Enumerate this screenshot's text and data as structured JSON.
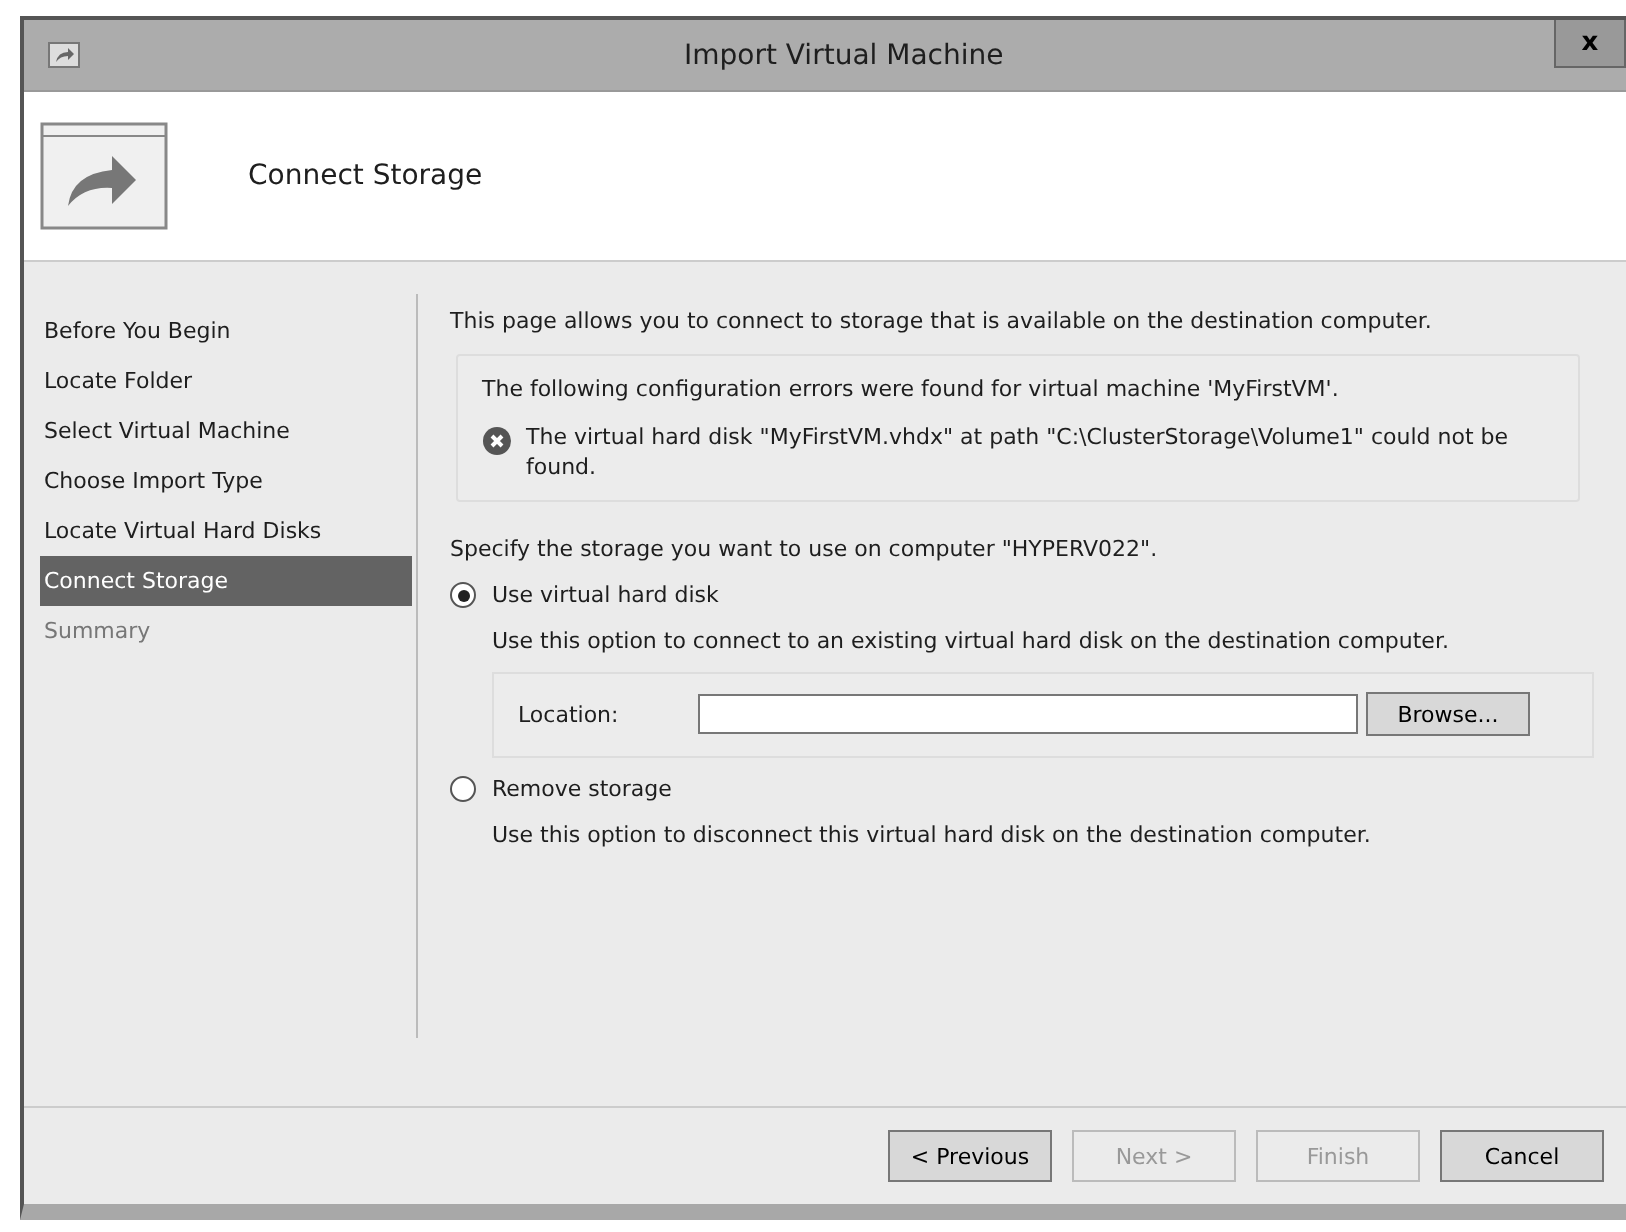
{
  "window": {
    "title": "Import Virtual Machine",
    "close": "x"
  },
  "header": {
    "title": "Connect Storage"
  },
  "steps": [
    {
      "label": "Before You Begin",
      "selected": false,
      "disabled": false
    },
    {
      "label": "Locate Folder",
      "selected": false,
      "disabled": false
    },
    {
      "label": "Select Virtual Machine",
      "selected": false,
      "disabled": false
    },
    {
      "label": "Choose Import Type",
      "selected": false,
      "disabled": false
    },
    {
      "label": "Locate Virtual Hard Disks",
      "selected": false,
      "disabled": false
    },
    {
      "label": "Connect Storage",
      "selected": true,
      "disabled": false
    },
    {
      "label": "Summary",
      "selected": false,
      "disabled": true
    }
  ],
  "intro": "This page allows you to connect to storage that is available on the destination computer.",
  "errors": {
    "heading": "The following configuration errors were found for virtual machine 'MyFirstVM'.",
    "items": [
      "The virtual hard disk \"MyFirstVM.vhdx\" at path \"C:\\ClusterStorage\\Volume1\" could not be found."
    ]
  },
  "prompt": "Specify the storage you want to use on computer \"HYPERV022\".",
  "options": [
    {
      "label": "Use virtual hard disk",
      "description": "Use this option to connect to an existing virtual hard disk on the destination computer.",
      "selected": true,
      "location": {
        "label": "Location:",
        "button": "Browse..."
      }
    },
    {
      "label": "Remove storage",
      "description": "Use this option to disconnect this virtual hard disk on the destination computer.",
      "selected": false
    }
  ],
  "buttons": [
    {
      "label": "< Previous",
      "disabled": false
    },
    {
      "label": "Next >",
      "disabled": true
    },
    {
      "label": "Finish",
      "disabled": true
    },
    {
      "label": "Cancel",
      "disabled": false
    }
  ]
}
